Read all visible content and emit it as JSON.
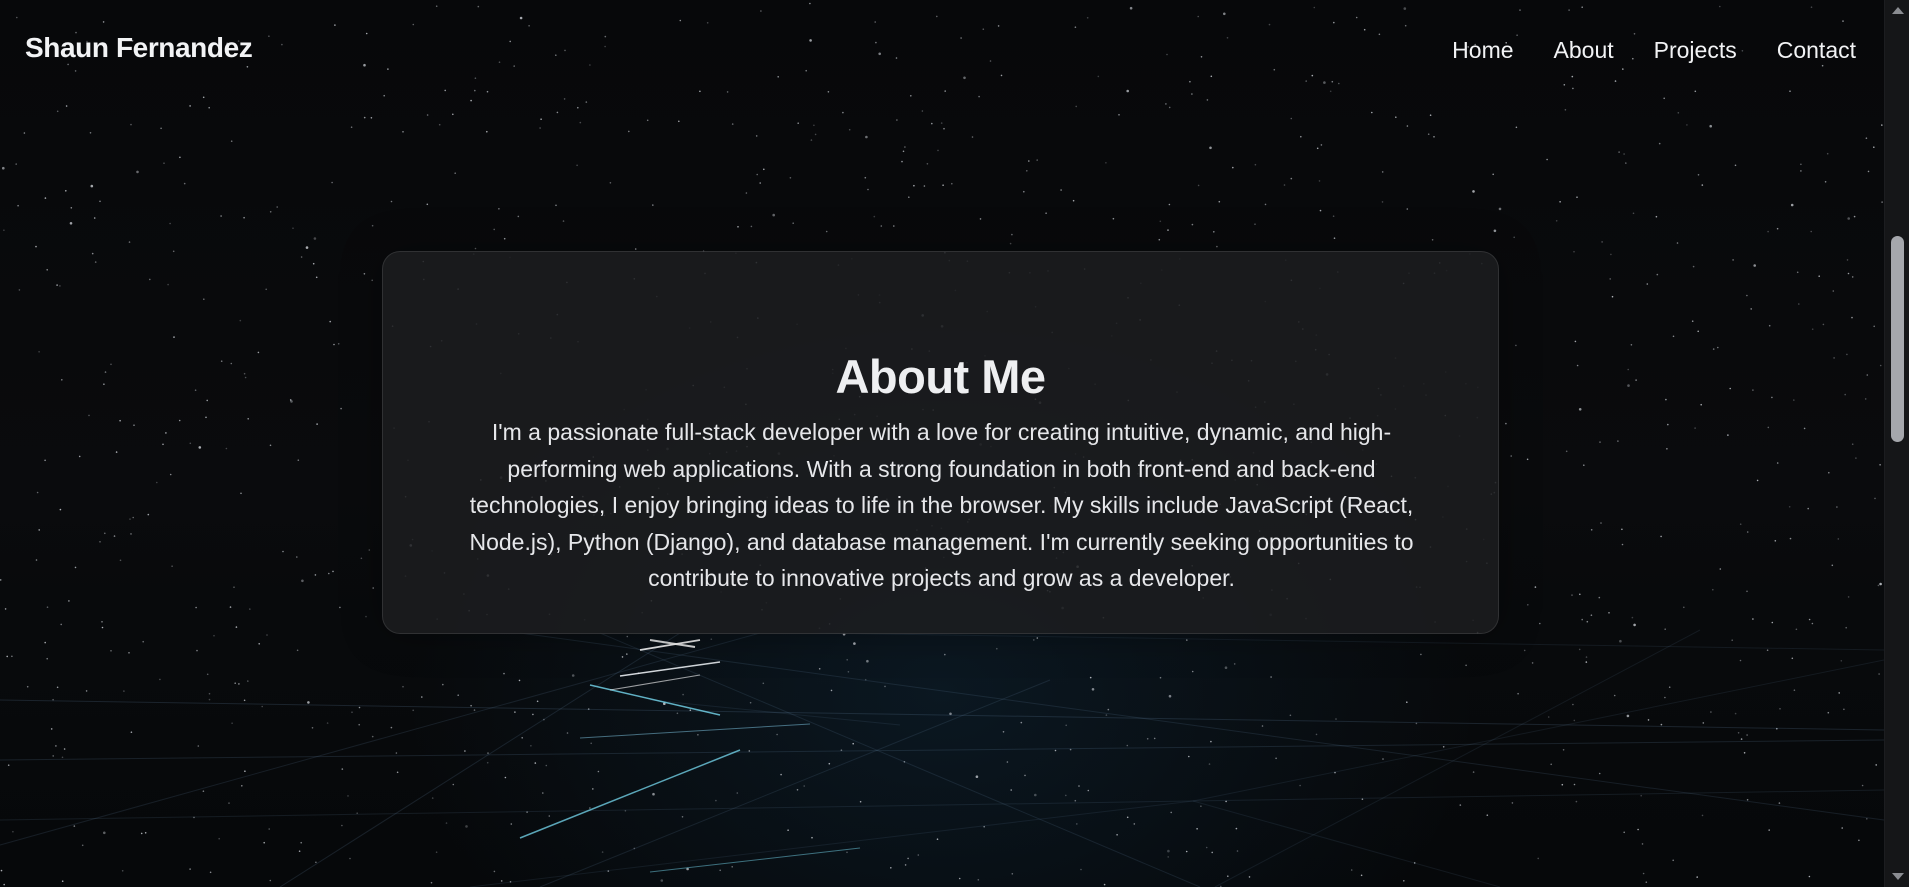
{
  "brand": {
    "name": "Shaun Fernandez"
  },
  "nav": {
    "items": [
      {
        "label": "Home"
      },
      {
        "label": "About"
      },
      {
        "label": "Projects"
      },
      {
        "label": "Contact"
      }
    ]
  },
  "about": {
    "title": "About Me",
    "description": "I'm a passionate full-stack developer with a love for creating intuitive, dynamic, and high-performing web applications. With a strong foundation in both front-end and back-end technologies, I enjoy bringing ideas to life in the browser. My skills include JavaScript (React, Node.js), Python (Django), and database management. I'm currently seeking opportunities to contribute to innovative projects and grow as a developer."
  },
  "theme": {
    "background": "#07080a",
    "text": "#f2f3f5",
    "card": "#1c1d1f",
    "accent": "#4ec4ff"
  }
}
